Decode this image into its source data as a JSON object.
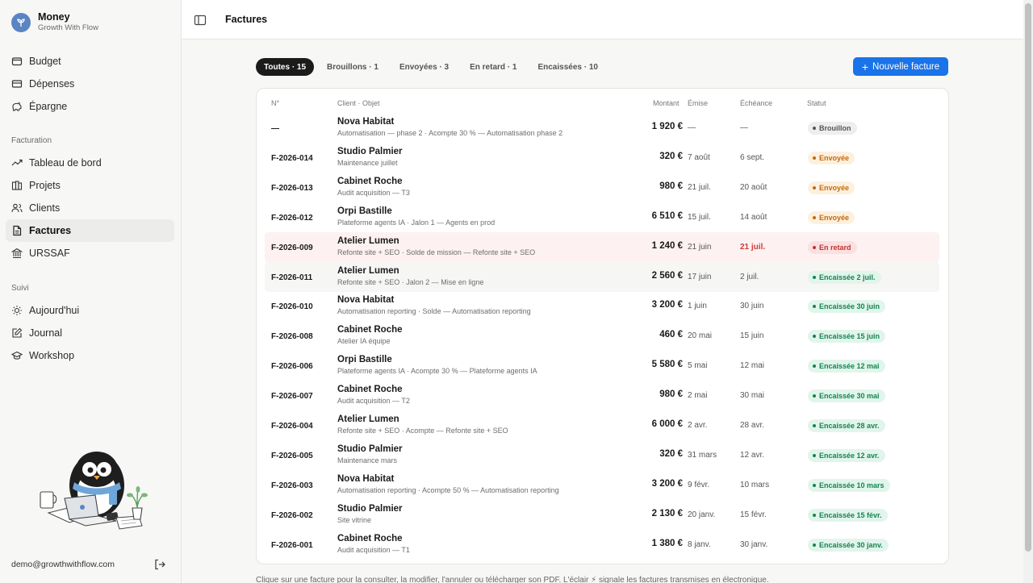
{
  "brand": {
    "name": "Money",
    "subtitle": "Growth With Flow"
  },
  "sidebar": {
    "nav_top": [
      {
        "label": "Budget",
        "icon": "wallet-icon"
      },
      {
        "label": "Dépenses",
        "icon": "card-icon"
      },
      {
        "label": "Épargne",
        "icon": "piggy-icon"
      }
    ],
    "section_facturation": "Facturation",
    "nav_facturation": [
      {
        "label": "Tableau de bord",
        "icon": "trend-icon"
      },
      {
        "label": "Projets",
        "icon": "folder-icon"
      },
      {
        "label": "Clients",
        "icon": "users-icon"
      },
      {
        "label": "Factures",
        "icon": "file-icon"
      },
      {
        "label": "URSSAF",
        "icon": "bank-icon"
      }
    ],
    "section_suivi": "Suivi",
    "nav_suivi": [
      {
        "label": "Aujourd'hui",
        "icon": "sun-icon"
      },
      {
        "label": "Journal",
        "icon": "edit-icon"
      },
      {
        "label": "Workshop",
        "icon": "cap-icon"
      }
    ],
    "email": "demo@growthwithflow.com"
  },
  "header": {
    "title": "Factures"
  },
  "tabs": [
    "Toutes · 15",
    "Brouillons · 1",
    "Envoyées · 3",
    "En retard · 1",
    "Encaissées · 10"
  ],
  "new_button": "Nouvelle facture",
  "columns": {
    "num": "N°",
    "client": "Client · Objet",
    "amount": "Montant",
    "issued": "Émise",
    "due": "Échéance",
    "status": "Statut"
  },
  "invoices": [
    {
      "num": "—",
      "client": "Nova Habitat",
      "obj": "Automatisation — phase 2 · Acompte 30 % — Automatisation phase 2",
      "amount": "1 920 €",
      "issued": "—",
      "due": "—",
      "status": "Brouillon",
      "kind": "draft"
    },
    {
      "num": "F-2026-014",
      "client": "Studio Palmier",
      "obj": "Maintenance juillet",
      "amount": "320 €",
      "issued": "7 août",
      "due": "6 sept.",
      "status": "Envoyée",
      "kind": "sent"
    },
    {
      "num": "F-2026-013",
      "client": "Cabinet Roche",
      "obj": "Audit acquisition — T3",
      "amount": "980 €",
      "issued": "21 juil.",
      "due": "20 août",
      "status": "Envoyée",
      "kind": "sent"
    },
    {
      "num": "F-2026-012",
      "client": "Orpi Bastille",
      "obj": "Plateforme agents IA · Jalon 1 — Agents en prod",
      "amount": "6 510 €",
      "issued": "15 juil.",
      "due": "14 août",
      "status": "Envoyée",
      "kind": "sent"
    },
    {
      "num": "F-2026-009",
      "client": "Atelier Lumen",
      "obj": "Refonte site + SEO · Solde de mission — Refonte site + SEO",
      "amount": "1 240 €",
      "issued": "21 juin",
      "due": "21 juil.",
      "status": "En retard",
      "kind": "late"
    },
    {
      "num": "F-2026-011",
      "client": "Atelier Lumen",
      "obj": "Refonte site + SEO · Jalon 2 — Mise en ligne",
      "amount": "2 560 €",
      "issued": "17 juin",
      "due": "2 juil.",
      "status": "Encaissée 2 juil.",
      "kind": "paid"
    },
    {
      "num": "F-2026-010",
      "client": "Nova Habitat",
      "obj": "Automatisation reporting · Solde — Automatisation reporting",
      "amount": "3 200 €",
      "issued": "1 juin",
      "due": "30 juin",
      "status": "Encaissée 30 juin",
      "kind": "paid"
    },
    {
      "num": "F-2026-008",
      "client": "Cabinet Roche",
      "obj": "Atelier IA équipe",
      "amount": "460 €",
      "issued": "20 mai",
      "due": "15 juin",
      "status": "Encaissée 15 juin",
      "kind": "paid"
    },
    {
      "num": "F-2026-006",
      "client": "Orpi Bastille",
      "obj": "Plateforme agents IA · Acompte 30 % — Plateforme agents IA",
      "amount": "5 580 €",
      "issued": "5 mai",
      "due": "12 mai",
      "status": "Encaissée 12 mai",
      "kind": "paid"
    },
    {
      "num": "F-2026-007",
      "client": "Cabinet Roche",
      "obj": "Audit acquisition — T2",
      "amount": "980 €",
      "issued": "2 mai",
      "due": "30 mai",
      "status": "Encaissée 30 mai",
      "kind": "paid"
    },
    {
      "num": "F-2026-004",
      "client": "Atelier Lumen",
      "obj": "Refonte site + SEO · Acompte — Refonte site + SEO",
      "amount": "6 000 €",
      "issued": "2 avr.",
      "due": "28 avr.",
      "status": "Encaissée 28 avr.",
      "kind": "paid"
    },
    {
      "num": "F-2026-005",
      "client": "Studio Palmier",
      "obj": "Maintenance mars",
      "amount": "320 €",
      "issued": "31 mars",
      "due": "12 avr.",
      "status": "Encaissée 12 avr.",
      "kind": "paid"
    },
    {
      "num": "F-2026-003",
      "client": "Nova Habitat",
      "obj": "Automatisation reporting · Acompte 50 % — Automatisation reporting",
      "amount": "3 200 €",
      "issued": "9 févr.",
      "due": "10 mars",
      "status": "Encaissée 10 mars",
      "kind": "paid"
    },
    {
      "num": "F-2026-002",
      "client": "Studio Palmier",
      "obj": "Site vitrine",
      "amount": "2 130 €",
      "issued": "20 janv.",
      "due": "15 févr.",
      "status": "Encaissée 15 févr.",
      "kind": "paid"
    },
    {
      "num": "F-2026-001",
      "client": "Cabinet Roche",
      "obj": "Audit acquisition — T1",
      "amount": "1 380 €",
      "issued": "8 janv.",
      "due": "30 janv.",
      "status": "Encaissée 30 janv.",
      "kind": "paid"
    }
  ],
  "footnote": "Clique sur une facture pour la consulter, la modifier, l'annuler ou télécharger son PDF. L'éclair ⚡ signale les factures transmises en électronique."
}
